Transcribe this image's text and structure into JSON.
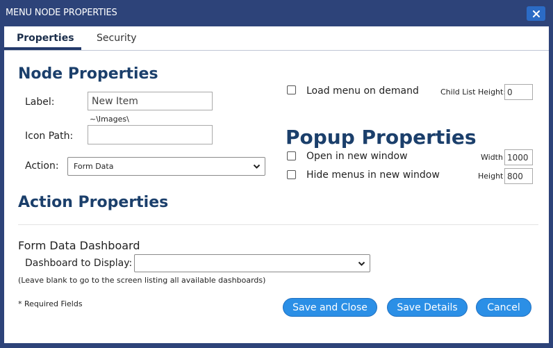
{
  "window": {
    "title": "MENU NODE PROPERTIES",
    "close_icon": "close-icon"
  },
  "tabs": [
    {
      "label": "Properties",
      "active": true
    },
    {
      "label": "Security",
      "active": false
    }
  ],
  "node_properties": {
    "heading": "Node Properties",
    "label_label": "Label:",
    "label_value": "New Item",
    "icon_hint": "~\\Images\\",
    "icon_path_label": "Icon Path:",
    "icon_path_value": "",
    "action_label": "Action:",
    "action_selected": "Form Data"
  },
  "load_menu": {
    "label": "Load menu on demand",
    "checked": false,
    "child_list_height_label": "Child List Height:",
    "child_list_height_value": "0"
  },
  "popup": {
    "heading": "Popup Properties",
    "open_new_window_label": "Open in new window",
    "open_new_window_checked": false,
    "hide_menus_label": "Hide menus in new window",
    "hide_menus_checked": false,
    "width_label": "Width",
    "width_value": "1000",
    "height_label": "Height",
    "height_value": "800"
  },
  "action_properties": {
    "heading": "Action Properties",
    "section_title": "Form Data Dashboard",
    "dashboard_label": "Dashboard to Display:",
    "dashboard_selected": "",
    "hint": "(Leave blank to go to the screen listing all available dashboards)"
  },
  "footer": {
    "required_note": "* Required Fields",
    "save_close": "Save and Close",
    "save_details": "Save Details",
    "cancel": "Cancel"
  },
  "colors": {
    "titlebar": "#2d4379",
    "heading": "#1b3f6b",
    "button": "#2b8fe6",
    "close": "#2b6bc5"
  }
}
